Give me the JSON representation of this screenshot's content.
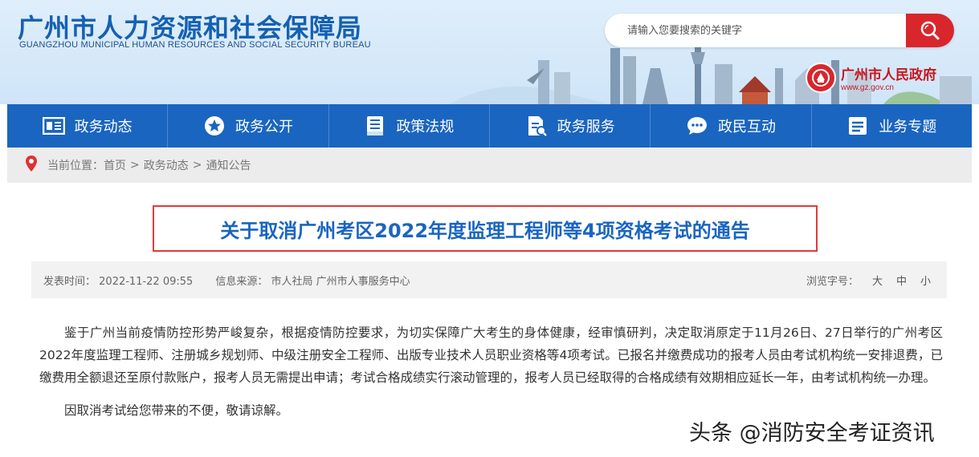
{
  "header": {
    "title": "广州市人力资源和社会保障局",
    "subtitle": "GUANGZHOU MUNICIPAL HUMAN RESOURCES AND SOCIAL SECURITY BUREAU",
    "search_placeholder": "请输入您要搜索的关键字",
    "search_icon": "search-icon",
    "gov_name": "广州市人民政府",
    "gov_url": "www.gz.gov.cn"
  },
  "nav": {
    "items": [
      {
        "label": "政务动态",
        "icon": "news-icon"
      },
      {
        "label": "政务公开",
        "icon": "star-icon"
      },
      {
        "label": "政策法规",
        "icon": "book-icon"
      },
      {
        "label": "政务服务",
        "icon": "document-icon"
      },
      {
        "label": "政民互动",
        "icon": "chat-icon"
      },
      {
        "label": "业务专题",
        "icon": "list-icon"
      }
    ]
  },
  "breadcrumb": {
    "prefix": "当前位置：",
    "home": "首页",
    "section": "政务动态",
    "current": "通知公告",
    "sep": ">"
  },
  "article": {
    "title": "关于取消广州考区2022年度监理工程师等4项资格考试的通告",
    "publish_label": "发表时间：",
    "publish_time": "2022-11-22 09:55",
    "source_label": "信息来源：",
    "source": "市人社局 广州市人事服务中心",
    "font_label": "浏览字号：",
    "font_large": "大",
    "font_medium": "中",
    "font_small": "小",
    "paragraph1": "鉴于广州当前疫情防控形势严峻复杂，根据疫情防控要求，为切实保障广大考生的身体健康，经审慎研判，决定取消原定于11月26日、27日举行的广州考区2022年度监理工程师、注册城乡规划师、中级注册安全工程师、出版专业技术人员职业资格等4项考试。已报名并缴费成功的报考人员由考试机构统一安排退费，已缴费用全额退还至原付款账户，报考人员无需提出申请；考试合格成绩实行滚动管理的，报考人员已经取得的合格成绩有效期相应延长一年，由考试机构统一办理。",
    "paragraph2": "因取消考试给您带来的不便，敬请谅解。"
  },
  "watermark": "头条 @消防安全考证资讯",
  "colors": {
    "brand_blue": "#1a65c0",
    "accent_red": "#d9262d",
    "title_frame_red": "#e23a3a"
  }
}
